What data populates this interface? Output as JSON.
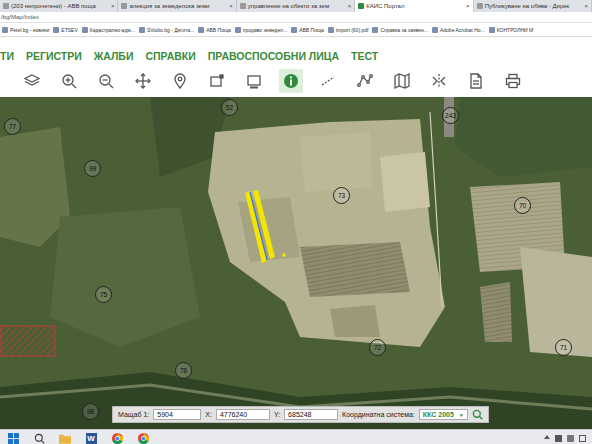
{
  "browser": {
    "tabs": [
      {
        "label": "(203 непрочетени) - АВВ поща",
        "selected": false
      },
      {
        "label": "алекция за земеделска земи",
        "selected": false
      },
      {
        "label": "управление на обекти за зем",
        "selected": false
      },
      {
        "label": "КАИС Портал",
        "selected": true
      },
      {
        "label": "Публикуване на обява - Дирек",
        "selected": false
      }
    ],
    "tabClose": "×",
    "address": "/bg/Map/Index",
    "bookmarks": [
      "Petel.bg - новини",
      "ETSEV",
      "Кадастрално-адм...",
      "SVodio.bg - Дигита...",
      "АВВ Поща",
      "продаво земедел...",
      "АВВ Поща",
      "import (60).pdf",
      "Справка за заявен...",
      "Adobe Acrobat Ho...",
      "КОНТРОЛНИ М"
    ]
  },
  "menu": [
    "ТИ",
    "РЕГИСТРИ",
    "ЖАЛБИ",
    "СПРАВКИ",
    "ПРАВОСПОСОБНИ ЛИЦА",
    "ТЕСТ"
  ],
  "toolbar": [
    {
      "kind": "layers",
      "selected": false
    },
    {
      "kind": "zoom-in",
      "selected": false
    },
    {
      "kind": "zoom-out",
      "selected": false
    },
    {
      "kind": "pan",
      "selected": false
    },
    {
      "kind": "pin",
      "selected": false
    },
    {
      "kind": "rect-select",
      "selected": false
    },
    {
      "kind": "rect",
      "selected": false
    },
    {
      "kind": "info",
      "selected": true
    },
    {
      "kind": "measure",
      "selected": false
    },
    {
      "kind": "polyline",
      "selected": false
    },
    {
      "kind": "map",
      "selected": false
    },
    {
      "kind": "split",
      "selected": false
    },
    {
      "kind": "document",
      "selected": false
    },
    {
      "kind": "print",
      "selected": false
    }
  ],
  "map": {
    "parcels": [
      "77",
      "99",
      "52",
      "73",
      "243",
      "70",
      "75",
      "72",
      "71",
      "78",
      "98"
    ],
    "selection": true,
    "restrictedZone": true
  },
  "coordinates": {
    "scaleLabel": "Мащаб 1:",
    "scale": "5904",
    "xLabel": "X:",
    "x": "4776240",
    "yLabel": "Y:",
    "y": "685248",
    "crsLabel": "Координатна система:",
    "crs": "ККС 2005",
    "dropdown": "▼"
  },
  "taskbar": {
    "apps": [
      {
        "kind": "start",
        "label": ""
      },
      {
        "kind": "search",
        "label": ""
      },
      {
        "kind": "explorer",
        "label": ""
      },
      {
        "kind": "word",
        "label": "W"
      },
      {
        "kind": "chrome",
        "label": ""
      },
      {
        "kind": "chrome",
        "label": ""
      }
    ],
    "tray": [
      {
        "kind": "up"
      },
      {
        "kind": "network"
      },
      {
        "kind": "volume"
      },
      {
        "kind": "notification"
      }
    ]
  }
}
